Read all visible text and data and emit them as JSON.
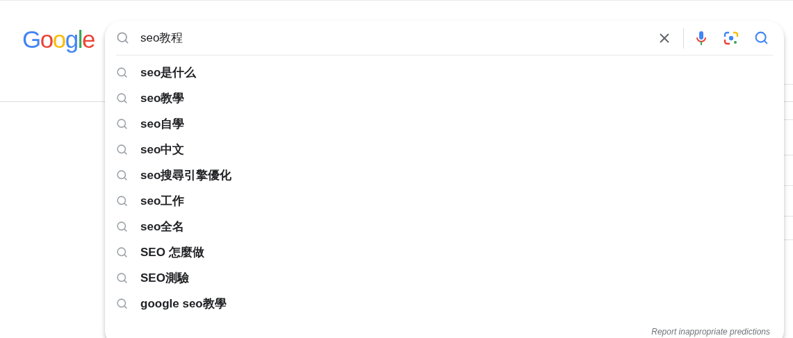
{
  "logo": "Google",
  "search": {
    "value": "seo教程"
  },
  "suggestions": [
    {
      "text": "seo是什么"
    },
    {
      "text": "seo教學"
    },
    {
      "text": "seo自學"
    },
    {
      "text": "seo中文"
    },
    {
      "text": "seo搜尋引擎優化"
    },
    {
      "text": "seo工作"
    },
    {
      "text": "seo全名"
    },
    {
      "text": "SEO 怎麼做"
    },
    {
      "text": "SEO測驗"
    },
    {
      "text": "google seo教學"
    }
  ],
  "report_link": "Report inappropriate predictions"
}
